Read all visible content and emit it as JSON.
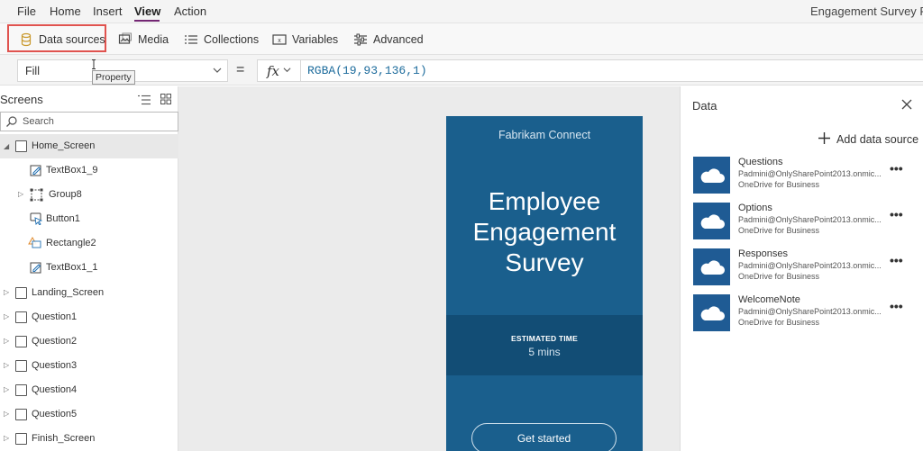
{
  "menu": {
    "items": [
      "File",
      "Home",
      "Insert",
      "View",
      "Action"
    ],
    "active": "View"
  },
  "app_title": "Engagement Survey Pho",
  "ribbon": {
    "data_sources": "Data sources",
    "media": "Media",
    "collections": "Collections",
    "variables": "Variables",
    "advanced": "Advanced"
  },
  "formula_bar": {
    "property": "Fill",
    "tooltip": "Property",
    "equals": "=",
    "fx": "fx",
    "formula": "RGBA(19,93,136,1)"
  },
  "screens_panel": {
    "title": "Screens",
    "search_placeholder": "Search",
    "tree": [
      {
        "label": "Home_Screen",
        "type": "screen",
        "expanded": true,
        "selected": true
      },
      {
        "label": "TextBox1_9",
        "type": "textbox"
      },
      {
        "label": "Group8",
        "type": "group"
      },
      {
        "label": "Button1",
        "type": "button"
      },
      {
        "label": "Rectangle2",
        "type": "rectangle"
      },
      {
        "label": "TextBox1_1",
        "type": "textbox"
      },
      {
        "label": "Landing_Screen",
        "type": "screen"
      },
      {
        "label": "Question1",
        "type": "screen"
      },
      {
        "label": "Question2",
        "type": "screen"
      },
      {
        "label": "Question3",
        "type": "screen"
      },
      {
        "label": "Question4",
        "type": "screen"
      },
      {
        "label": "Question5",
        "type": "screen"
      },
      {
        "label": "Finish_Screen",
        "type": "screen"
      }
    ]
  },
  "phone": {
    "brand": "Fabrikam Connect",
    "title_line1": "Employee",
    "title_line2": "Engagement",
    "title_line3": "Survey",
    "estimated_label": "ESTIMATED TIME",
    "estimated_value": "5 mins",
    "start_button": "Get started",
    "colors": {
      "background": "#135d88",
      "band": "#124d75"
    }
  },
  "data_pane": {
    "title": "Data",
    "add_label": "Add data source",
    "sources": [
      {
        "name": "Questions",
        "account": "Padmini@OnlySharePoint2013.onmic...",
        "type": "OneDrive for Business"
      },
      {
        "name": "Options",
        "account": "Padmini@OnlySharePoint2013.onmic...",
        "type": "OneDrive for Business"
      },
      {
        "name": "Responses",
        "account": "Padmini@OnlySharePoint2013.onmic...",
        "type": "OneDrive for Business"
      },
      {
        "name": "WelcomeNote",
        "account": "Padmini@OnlySharePoint2013.onmic...",
        "type": "OneDrive for Business"
      }
    ],
    "more_glyph": "•••"
  },
  "colors": {
    "accent": "#742774",
    "highlight": "#e0534f",
    "tile": "#1f5b94"
  },
  "icons": [
    "database-icon",
    "media-icon",
    "collections-icon",
    "variables-icon",
    "advanced-icon",
    "search-icon",
    "close-icon",
    "plus-icon",
    "onedrive-cloud-icon",
    "more-icon"
  ]
}
